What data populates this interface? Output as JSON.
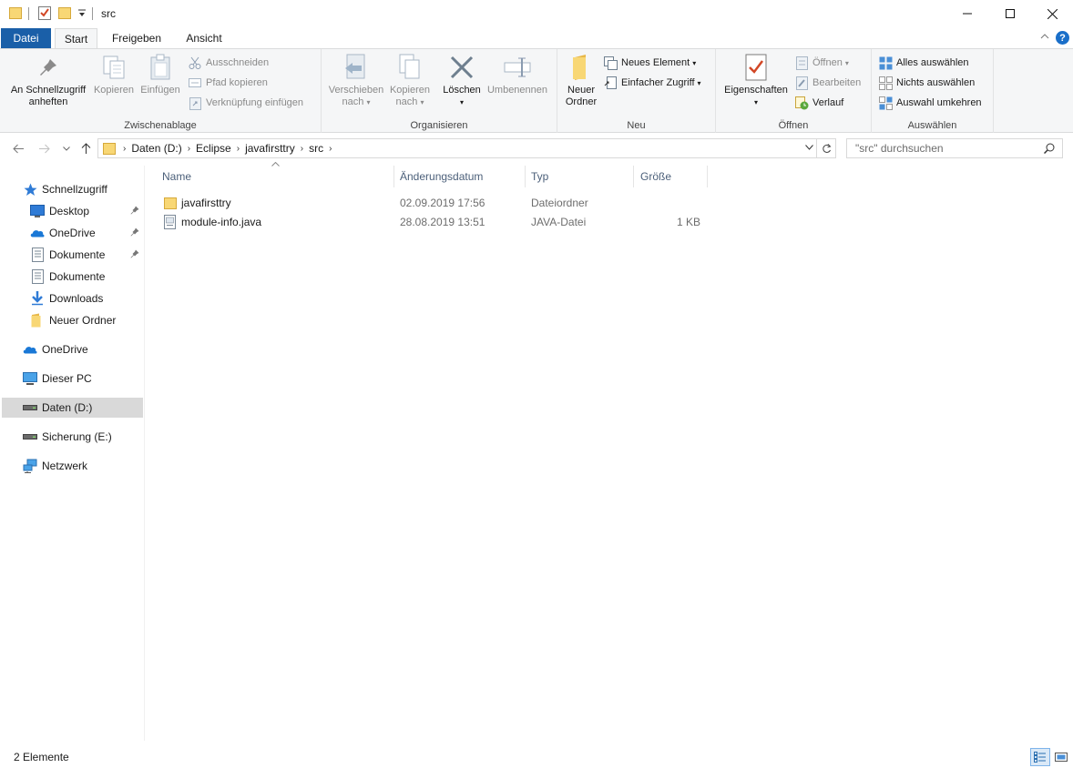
{
  "window": {
    "title": "src",
    "quick_access_icons": [
      "folder-icon",
      "properties-checklist-icon",
      "new-folder-icon",
      "customize-dropdown-icon"
    ]
  },
  "ribbon_tabs": [
    {
      "label": "Datei"
    },
    {
      "label": "Start"
    },
    {
      "label": "Freigeben"
    },
    {
      "label": "Ansicht"
    }
  ],
  "ribbon": {
    "clipboard": {
      "group_label": "Zwischenablage",
      "pin_line1": "An Schnellzugriff",
      "pin_line2": "anheften",
      "copy": "Kopieren",
      "paste": "Einfügen",
      "cut": "Ausschneiden",
      "copy_path": "Pfad kopieren",
      "paste_shortcut": "Verknüpfung einfügen"
    },
    "organize": {
      "group_label": "Organisieren",
      "move_line1": "Verschieben",
      "move_line2": "nach",
      "copyto_line1": "Kopieren",
      "copyto_line2": "nach",
      "delete": "Löschen",
      "rename": "Umbenennen"
    },
    "new": {
      "group_label": "Neu",
      "folder_line1": "Neuer",
      "folder_line2": "Ordner",
      "new_item": "Neues Element",
      "easy_access": "Einfacher Zugriff"
    },
    "open": {
      "group_label": "Öffnen",
      "properties": "Eigenschaften",
      "open": "Öffnen",
      "edit": "Bearbeiten",
      "history": "Verlauf"
    },
    "select": {
      "group_label": "Auswählen",
      "select_all": "Alles auswählen",
      "select_none": "Nichts auswählen",
      "invert": "Auswahl umkehren"
    }
  },
  "address": {
    "breadcrumb": [
      "Daten (D:)",
      "Eclipse",
      "javafirsttry",
      "src"
    ],
    "search_placeholder": "\"src\" durchsuchen"
  },
  "nav_pane": {
    "quick_access": "Schnellzugriff",
    "quick_items": [
      {
        "label": "Desktop",
        "icon": "desktop-icon",
        "pinned": true
      },
      {
        "label": "OneDrive",
        "icon": "onedrive-cloud-icon",
        "pinned": true
      },
      {
        "label": "Dokumente",
        "icon": "documents-icon",
        "pinned": true
      },
      {
        "label": "Dokumente",
        "icon": "documents-icon",
        "pinned": false
      },
      {
        "label": "Downloads",
        "icon": "downloads-icon",
        "pinned": false
      },
      {
        "label": "Neuer Ordner",
        "icon": "folder-icon",
        "pinned": false
      }
    ],
    "roots": [
      {
        "label": "OneDrive",
        "icon": "onedrive-cloud-icon"
      },
      {
        "label": "Dieser PC",
        "icon": "pc-monitor-icon"
      },
      {
        "label": "Daten (D:)",
        "icon": "drive-icon",
        "selected": true
      },
      {
        "label": "Sicherung (E:)",
        "icon": "drive-icon"
      },
      {
        "label": "Netzwerk",
        "icon": "network-icon"
      }
    ]
  },
  "file_list": {
    "columns": [
      "Name",
      "Änderungsdatum",
      "Typ",
      "Größe"
    ],
    "rows": [
      {
        "name": "javafirsttry",
        "date": "02.09.2019 17:56",
        "type": "Dateiordner",
        "size": "",
        "icon": "folder-icon"
      },
      {
        "name": "module-info.java",
        "date": "28.08.2019 13:51",
        "type": "JAVA-Datei",
        "size": "1 KB",
        "icon": "java-file-icon"
      }
    ]
  },
  "status_bar": {
    "item_count": "2 Elemente"
  },
  "colors": {
    "accent": "#1a5fa8",
    "folder": "#f8d775",
    "selected_nav": "#d9d9d9"
  }
}
